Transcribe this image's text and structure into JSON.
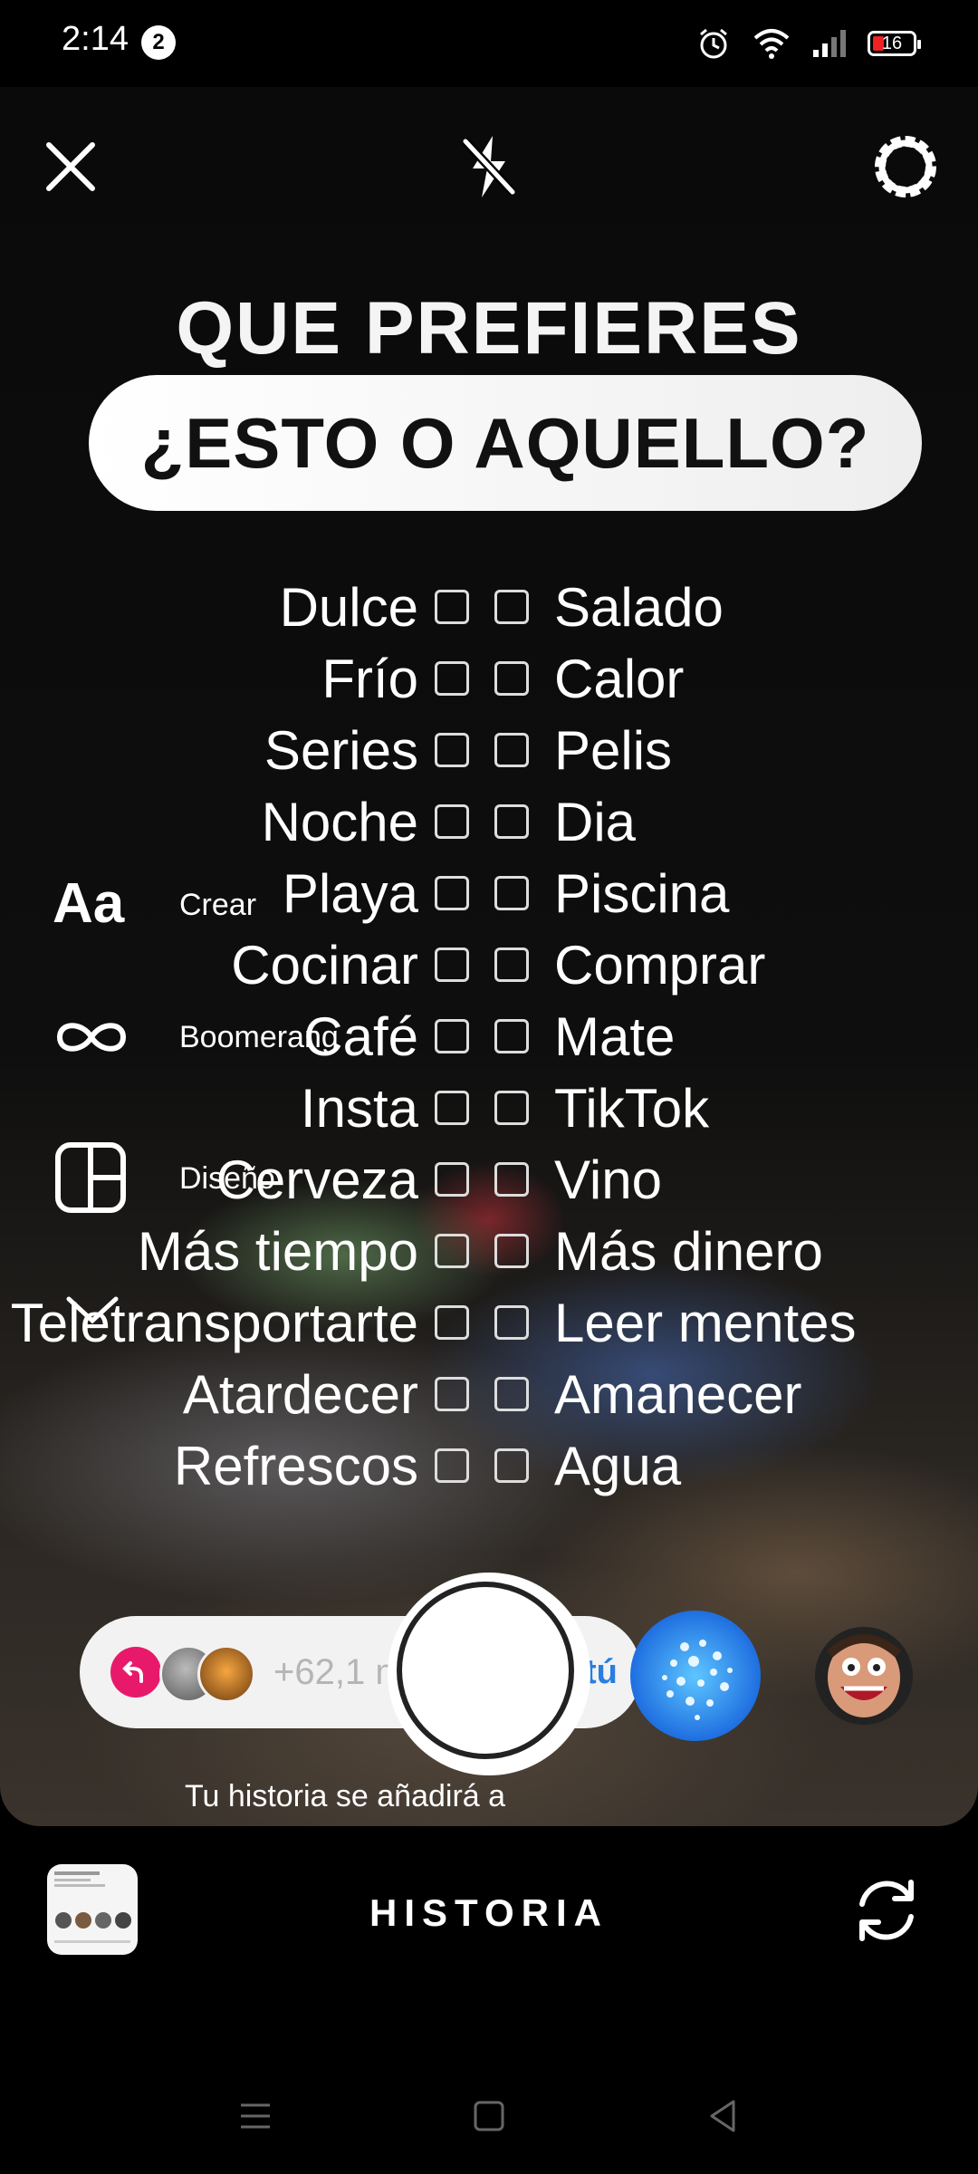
{
  "status_bar": {
    "time": "2:14",
    "notification_count": "2",
    "battery": "16",
    "icons": [
      "alarm-icon",
      "wifi-icon",
      "signal-icon",
      "battery-icon"
    ]
  },
  "top_controls": {
    "icons": [
      "close-icon",
      "flash-off-icon",
      "settings-icon"
    ]
  },
  "content": {
    "headline": "QUE PREFIERES",
    "pill": "¿ESTO O AQUELLO?",
    "choices": [
      {
        "left": "Dulce",
        "right": "Salado"
      },
      {
        "left": "Frío",
        "right": "Calor"
      },
      {
        "left": "Series",
        "right": "Pelis"
      },
      {
        "left": "Noche",
        "right": "Dia"
      },
      {
        "left": "Playa",
        "right": "Piscina"
      },
      {
        "left": "Cocinar",
        "right": "Comprar"
      },
      {
        "left": "Café",
        "right": "Mate"
      },
      {
        "left": "Insta",
        "right": "TikTok"
      },
      {
        "left": "Cerveza",
        "right": "Vino"
      },
      {
        "left": "Más tiempo",
        "right": "Más dinero"
      },
      {
        "left": "Teletransportarte",
        "right": "Leer mentes"
      },
      {
        "left": "Atardecer",
        "right": "Amanecer"
      },
      {
        "left": "Refrescos",
        "right": "Agua"
      }
    ]
  },
  "side_tools": {
    "create_icon": "Aa",
    "create_label": "Crear",
    "boomerang_label": "Boomerang",
    "layout_label": "Diseño"
  },
  "capture": {
    "followers_text": "+62,1 m",
    "tu_text": "tú",
    "story_note": "Tu historia se añadirá a"
  },
  "mode_bar": {
    "mode": "HISTORIA"
  },
  "colors": {
    "accent_pink": "#e8196b",
    "link_blue": "#2a7de1",
    "effect_blue": "#1f6fe0"
  }
}
